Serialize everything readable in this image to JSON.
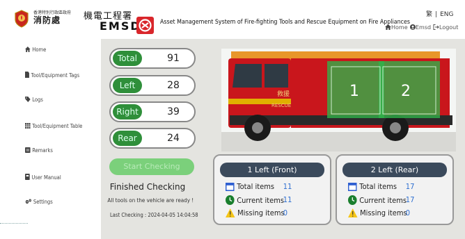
{
  "header": {
    "hkfs_org_en": "香港特別行政區政府",
    "hkfs_name": "消防處",
    "emsd_name_cn": "機電工程署",
    "emsd_name_en": "EMSD",
    "system_title": "Asset Management System of Fire-fighting Tools and Rescue Equipment on Fire Appliances",
    "lang_tc": "繁",
    "lang_sep": "|",
    "lang_en": "ENG",
    "nav_home": "Home",
    "nav_user": "Emsd",
    "nav_logout": "Logout"
  },
  "sidebar": {
    "items": [
      {
        "label": "Home",
        "icon": "home-icon"
      },
      {
        "label": "Tool/Equipment Tags",
        "icon": "file-icon"
      },
      {
        "label": "Logs",
        "icon": "tag-icon"
      },
      {
        "label": "Tool/Equipment Table",
        "icon": "table-icon"
      },
      {
        "label": "Remarks",
        "icon": "comment-icon"
      },
      {
        "label": "User Manual",
        "icon": "book-icon"
      },
      {
        "label": "Settings",
        "icon": "gears-icon"
      }
    ]
  },
  "stats": [
    {
      "label": "Total",
      "value": "91"
    },
    {
      "label": "Left",
      "value": "28"
    },
    {
      "label": "Right",
      "value": "39"
    },
    {
      "label": "Rear",
      "value": "24"
    }
  ],
  "actions": {
    "start_checking": "Start Checking"
  },
  "status": {
    "title": "Finished Checking",
    "message": "All tools on the vehicle are ready !",
    "last_checking": "Last Checking : 2024-04-05 14:04:58"
  },
  "truck": {
    "overlay_1": "1",
    "overlay_2": "2",
    "cab_text_cn": "救援",
    "cab_text_en": "RESCUE"
  },
  "panels": [
    {
      "title": "1 Left (Front)",
      "total_label": "Total items",
      "total": "11",
      "current_label": "Current items",
      "current": "11",
      "missing_label": "Missing items",
      "missing": "0"
    },
    {
      "title": "2 Left (Rear)",
      "total_label": "Total items",
      "total": "17",
      "current_label": "Current items",
      "current": "17",
      "missing_label": "Missing items",
      "missing": "0"
    }
  ],
  "colors": {
    "stat_label_bg": "#2f8f3a",
    "start_button_bg": "#7bd07b",
    "panel_header_bg": "#3b4a5c",
    "count_value": "#2e6fd1",
    "emsd_red": "#d9262b",
    "compartment_overlay": "#2fb34a"
  }
}
